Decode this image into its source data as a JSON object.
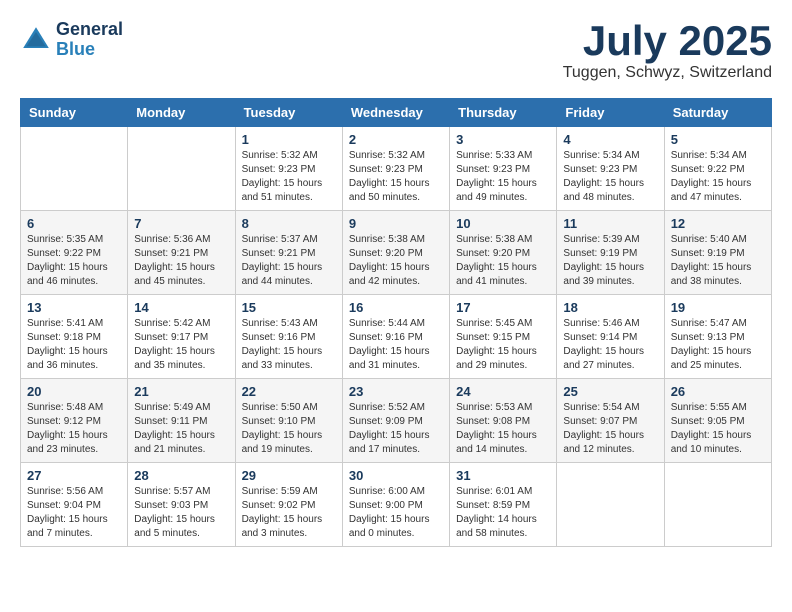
{
  "header": {
    "logo_line1": "General",
    "logo_line2": "Blue",
    "month": "July 2025",
    "location": "Tuggen, Schwyz, Switzerland"
  },
  "weekdays": [
    "Sunday",
    "Monday",
    "Tuesday",
    "Wednesday",
    "Thursday",
    "Friday",
    "Saturday"
  ],
  "weeks": [
    [
      {
        "day": "",
        "sunrise": "",
        "sunset": "",
        "daylight": ""
      },
      {
        "day": "",
        "sunrise": "",
        "sunset": "",
        "daylight": ""
      },
      {
        "day": "1",
        "sunrise": "Sunrise: 5:32 AM",
        "sunset": "Sunset: 9:23 PM",
        "daylight": "Daylight: 15 hours and 51 minutes."
      },
      {
        "day": "2",
        "sunrise": "Sunrise: 5:32 AM",
        "sunset": "Sunset: 9:23 PM",
        "daylight": "Daylight: 15 hours and 50 minutes."
      },
      {
        "day": "3",
        "sunrise": "Sunrise: 5:33 AM",
        "sunset": "Sunset: 9:23 PM",
        "daylight": "Daylight: 15 hours and 49 minutes."
      },
      {
        "day": "4",
        "sunrise": "Sunrise: 5:34 AM",
        "sunset": "Sunset: 9:23 PM",
        "daylight": "Daylight: 15 hours and 48 minutes."
      },
      {
        "day": "5",
        "sunrise": "Sunrise: 5:34 AM",
        "sunset": "Sunset: 9:22 PM",
        "daylight": "Daylight: 15 hours and 47 minutes."
      }
    ],
    [
      {
        "day": "6",
        "sunrise": "Sunrise: 5:35 AM",
        "sunset": "Sunset: 9:22 PM",
        "daylight": "Daylight: 15 hours and 46 minutes."
      },
      {
        "day": "7",
        "sunrise": "Sunrise: 5:36 AM",
        "sunset": "Sunset: 9:21 PM",
        "daylight": "Daylight: 15 hours and 45 minutes."
      },
      {
        "day": "8",
        "sunrise": "Sunrise: 5:37 AM",
        "sunset": "Sunset: 9:21 PM",
        "daylight": "Daylight: 15 hours and 44 minutes."
      },
      {
        "day": "9",
        "sunrise": "Sunrise: 5:38 AM",
        "sunset": "Sunset: 9:20 PM",
        "daylight": "Daylight: 15 hours and 42 minutes."
      },
      {
        "day": "10",
        "sunrise": "Sunrise: 5:38 AM",
        "sunset": "Sunset: 9:20 PM",
        "daylight": "Daylight: 15 hours and 41 minutes."
      },
      {
        "day": "11",
        "sunrise": "Sunrise: 5:39 AM",
        "sunset": "Sunset: 9:19 PM",
        "daylight": "Daylight: 15 hours and 39 minutes."
      },
      {
        "day": "12",
        "sunrise": "Sunrise: 5:40 AM",
        "sunset": "Sunset: 9:19 PM",
        "daylight": "Daylight: 15 hours and 38 minutes."
      }
    ],
    [
      {
        "day": "13",
        "sunrise": "Sunrise: 5:41 AM",
        "sunset": "Sunset: 9:18 PM",
        "daylight": "Daylight: 15 hours and 36 minutes."
      },
      {
        "day": "14",
        "sunrise": "Sunrise: 5:42 AM",
        "sunset": "Sunset: 9:17 PM",
        "daylight": "Daylight: 15 hours and 35 minutes."
      },
      {
        "day": "15",
        "sunrise": "Sunrise: 5:43 AM",
        "sunset": "Sunset: 9:16 PM",
        "daylight": "Daylight: 15 hours and 33 minutes."
      },
      {
        "day": "16",
        "sunrise": "Sunrise: 5:44 AM",
        "sunset": "Sunset: 9:16 PM",
        "daylight": "Daylight: 15 hours and 31 minutes."
      },
      {
        "day": "17",
        "sunrise": "Sunrise: 5:45 AM",
        "sunset": "Sunset: 9:15 PM",
        "daylight": "Daylight: 15 hours and 29 minutes."
      },
      {
        "day": "18",
        "sunrise": "Sunrise: 5:46 AM",
        "sunset": "Sunset: 9:14 PM",
        "daylight": "Daylight: 15 hours and 27 minutes."
      },
      {
        "day": "19",
        "sunrise": "Sunrise: 5:47 AM",
        "sunset": "Sunset: 9:13 PM",
        "daylight": "Daylight: 15 hours and 25 minutes."
      }
    ],
    [
      {
        "day": "20",
        "sunrise": "Sunrise: 5:48 AM",
        "sunset": "Sunset: 9:12 PM",
        "daylight": "Daylight: 15 hours and 23 minutes."
      },
      {
        "day": "21",
        "sunrise": "Sunrise: 5:49 AM",
        "sunset": "Sunset: 9:11 PM",
        "daylight": "Daylight: 15 hours and 21 minutes."
      },
      {
        "day": "22",
        "sunrise": "Sunrise: 5:50 AM",
        "sunset": "Sunset: 9:10 PM",
        "daylight": "Daylight: 15 hours and 19 minutes."
      },
      {
        "day": "23",
        "sunrise": "Sunrise: 5:52 AM",
        "sunset": "Sunset: 9:09 PM",
        "daylight": "Daylight: 15 hours and 17 minutes."
      },
      {
        "day": "24",
        "sunrise": "Sunrise: 5:53 AM",
        "sunset": "Sunset: 9:08 PM",
        "daylight": "Daylight: 15 hours and 14 minutes."
      },
      {
        "day": "25",
        "sunrise": "Sunrise: 5:54 AM",
        "sunset": "Sunset: 9:07 PM",
        "daylight": "Daylight: 15 hours and 12 minutes."
      },
      {
        "day": "26",
        "sunrise": "Sunrise: 5:55 AM",
        "sunset": "Sunset: 9:05 PM",
        "daylight": "Daylight: 15 hours and 10 minutes."
      }
    ],
    [
      {
        "day": "27",
        "sunrise": "Sunrise: 5:56 AM",
        "sunset": "Sunset: 9:04 PM",
        "daylight": "Daylight: 15 hours and 7 minutes."
      },
      {
        "day": "28",
        "sunrise": "Sunrise: 5:57 AM",
        "sunset": "Sunset: 9:03 PM",
        "daylight": "Daylight: 15 hours and 5 minutes."
      },
      {
        "day": "29",
        "sunrise": "Sunrise: 5:59 AM",
        "sunset": "Sunset: 9:02 PM",
        "daylight": "Daylight: 15 hours and 3 minutes."
      },
      {
        "day": "30",
        "sunrise": "Sunrise: 6:00 AM",
        "sunset": "Sunset: 9:00 PM",
        "daylight": "Daylight: 15 hours and 0 minutes."
      },
      {
        "day": "31",
        "sunrise": "Sunrise: 6:01 AM",
        "sunset": "Sunset: 8:59 PM",
        "daylight": "Daylight: 14 hours and 58 minutes."
      },
      {
        "day": "",
        "sunrise": "",
        "sunset": "",
        "daylight": ""
      },
      {
        "day": "",
        "sunrise": "",
        "sunset": "",
        "daylight": ""
      }
    ]
  ]
}
